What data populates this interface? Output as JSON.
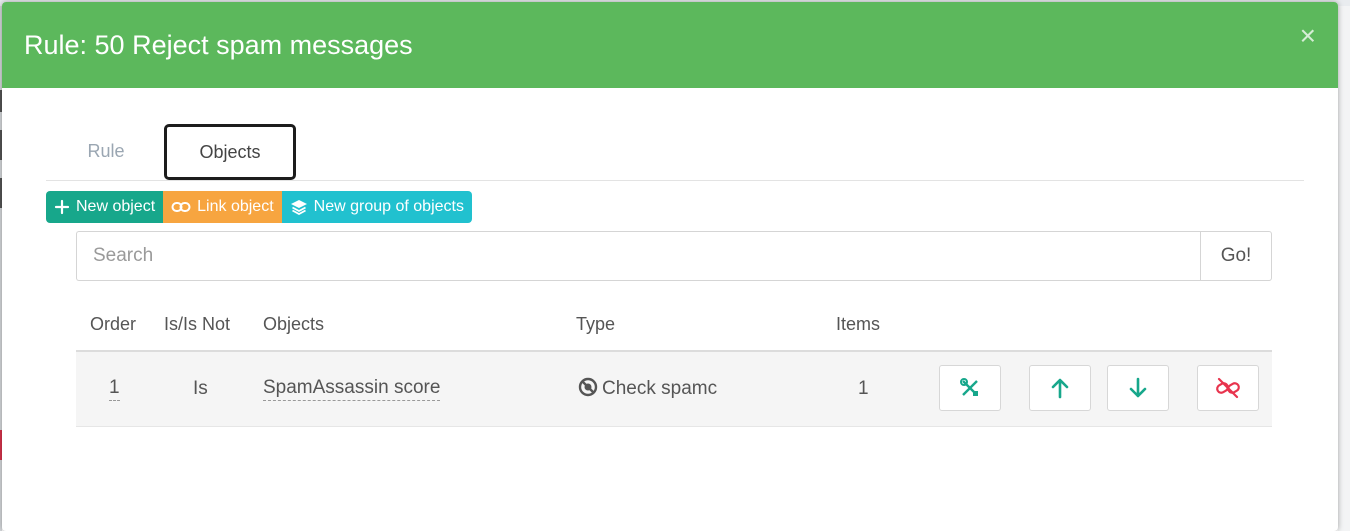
{
  "modal": {
    "title": "Rule: 50 Reject spam messages",
    "close_label": "×"
  },
  "tabs": [
    {
      "label": "Rule",
      "active": false
    },
    {
      "label": "Objects",
      "active": true
    }
  ],
  "toolbar": {
    "new_object": "New object",
    "link_object": "Link object",
    "new_group": "New group of objects"
  },
  "search": {
    "placeholder": "Search",
    "value": "",
    "go_label": "Go!"
  },
  "table": {
    "headers": [
      "Order",
      "Is/Is Not",
      "Objects",
      "Type",
      "Items"
    ],
    "rows": [
      {
        "order": "1",
        "is_not": "Is",
        "object": "SpamAssassin score",
        "type": "Check spamc",
        "items": "1"
      }
    ]
  },
  "colors": {
    "header_green": "#5cb85c",
    "new_object": "#17a78b",
    "link_object": "#f7a540",
    "new_group": "#21c1cf",
    "action_green": "#17a78b",
    "unlink_red": "#e8344e"
  },
  "icons": {
    "type": "spamc-icon",
    "actions": [
      "edit-tools-icon",
      "arrow-up-icon",
      "arrow-down-icon",
      "unlink-icon"
    ]
  }
}
